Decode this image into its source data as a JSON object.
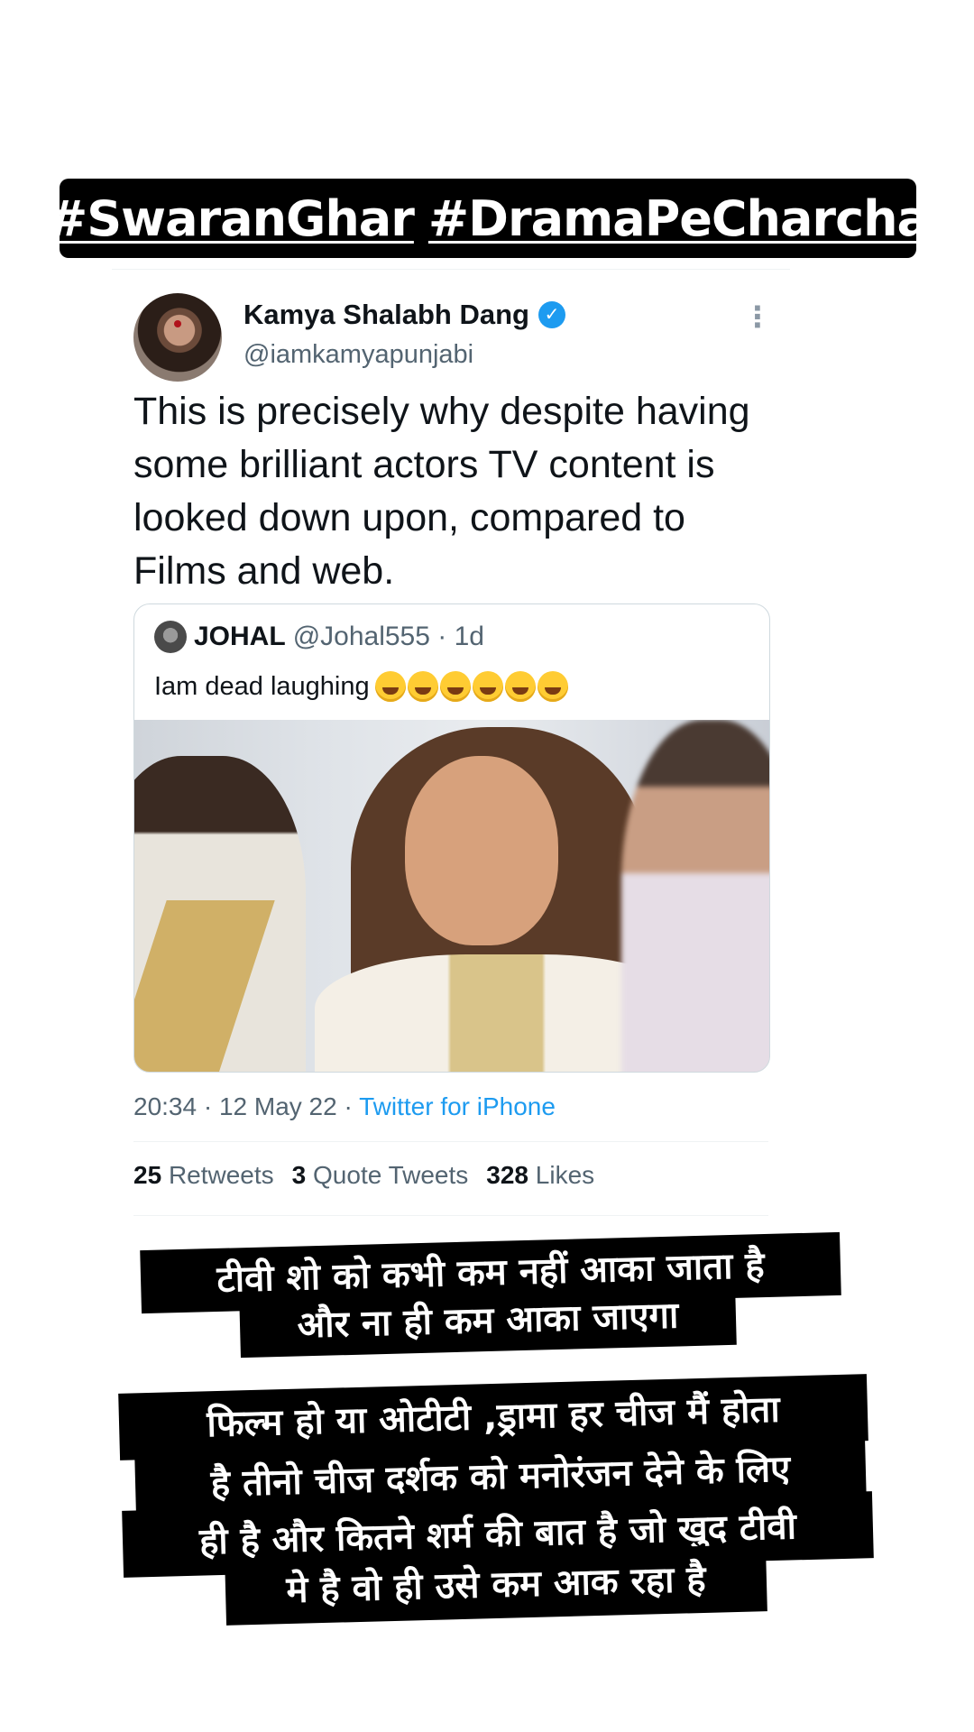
{
  "story": {
    "hashtags": [
      "#SwaranGhar",
      "#DramaPeCharcha"
    ]
  },
  "tweet": {
    "display_name": "Kamya Shalabh Dang",
    "verified_icon": "verified-badge-icon",
    "handle": "@iamkamyapunjabi",
    "text": "This is precisely why despite having some brilliant actors TV content is looked down upon, compared to Films and web.",
    "timestamp": "20:34 · 12 May 22 · ",
    "source": "Twitter for iPhone",
    "stats": {
      "retweets_count": "25",
      "retweets_label": "Retweets",
      "quote_count": "3",
      "quote_label": "Quote Tweets",
      "likes_count": "328",
      "likes_label": "Likes"
    },
    "quoted": {
      "name": "JOHAL",
      "meta": "@Johal555 · 1d",
      "text": "Iam dead laughing",
      "emoji_count": 6
    }
  },
  "captions": [
    "टीवी शो को कभी कम नहीं आका जाता है",
    "और ना ही कम आका जाएगा",
    "फिल्म हो या ओटीटी ,ड्रामा हर चीज मैं होता",
    "है तीनो चीज दर्शक को मनोरंजन देने के लिए",
    "ही है और कितने शर्म की बात है जो खुद टीवी",
    "मे  है वो ही उसे कम आक रहा है"
  ]
}
